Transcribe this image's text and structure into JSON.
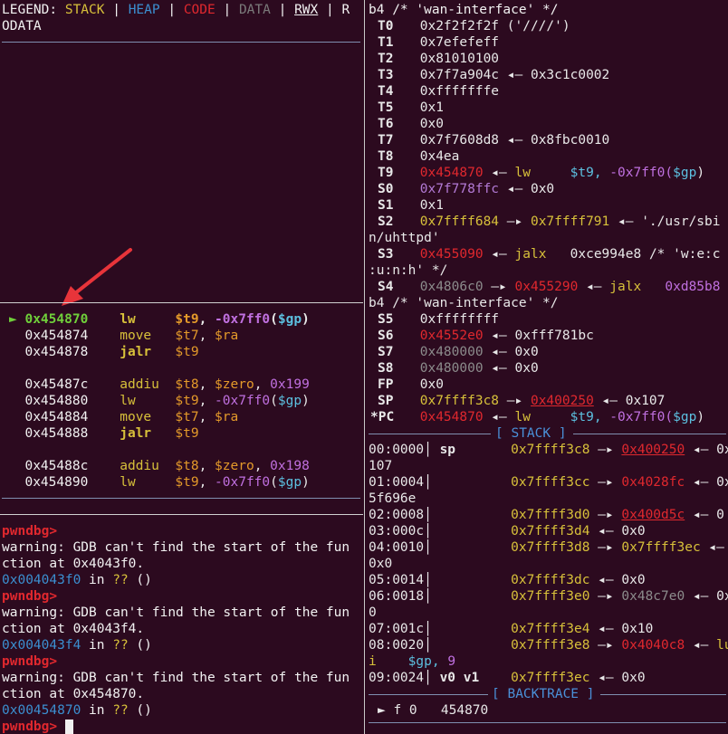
{
  "legend": {
    "label": "LEGEND: ",
    "stack": "STACK",
    "heap": "HEAP",
    "code": "CODE",
    "data": "DATA",
    "rwx": "RWX",
    "sep": " | ",
    "rodata_head": "R",
    "rodata_tail": "ODATA"
  },
  "disasm": {
    "rows": [
      {
        "marker": "►",
        "addr": "0x454870",
        "op": "lw",
        "args": [
          "$t9",
          "-0x7ff0",
          "$gp"
        ],
        "current": true
      },
      {
        "addr": "0x454874",
        "op": "move",
        "args": [
          "$t7",
          "$ra"
        ]
      },
      {
        "addr": "0x454878",
        "op": "jalr",
        "args": [
          "$t9"
        ]
      },
      {
        "addr": "0x45487c",
        "op": "addiu",
        "args": [
          "$t8",
          "$zero",
          "0x199"
        ]
      },
      {
        "addr": "0x454880",
        "op": "lw",
        "args": [
          "$t9",
          "-0x7ff0",
          "$gp"
        ]
      },
      {
        "addr": "0x454884",
        "op": "move",
        "args": [
          "$t7",
          "$ra"
        ]
      },
      {
        "addr": "0x454888",
        "op": "jalr",
        "args": [
          "$t9"
        ]
      },
      {
        "addr": "0x45488c",
        "op": "addiu",
        "args": [
          "$t8",
          "$zero",
          "0x198"
        ]
      },
      {
        "addr": "0x454890",
        "op": "lw",
        "args": [
          "$t9",
          "-0x7ff0",
          "$gp"
        ]
      }
    ]
  },
  "console": {
    "prompt": "pwndbg>",
    "warn1a": "warning: GDB can't find the start of the fun",
    "warn1b": "ction at 0x4043f0.",
    "addr1": "0x004043f0",
    "warn2a": "warning: GDB can't find the start of the fun",
    "warn2b": "ction at 0x4043f4.",
    "addr2": "0x004043f4",
    "warn3a": "warning: GDB can't find the start of the fun",
    "warn3b": "ction at 0x454870.",
    "addr3": "0x00454870",
    "in_text": " in ",
    "unknown": "??",
    "parens": " ()"
  },
  "registers": {
    "b4_line": "b4 /* 'wan-interface' */",
    "t0": "0x2f2f2f2f ('////')",
    "t1": "0x7efefeff",
    "t2": "0x81010100",
    "t3a": "0x7f7a904c",
    "t3b": "0x3c1c0002",
    "t4": "0xfffffffe",
    "t5": "0x1",
    "t6": "0x0",
    "t7a": "0x7f7608d8",
    "t7b": "0x8fbc0010",
    "t8": "0x4ea",
    "t9a": "0x454870",
    "t9op": "lw",
    "t9r": "$t9,",
    "t9o": "-0x7ff0(",
    "t9g": "$gp",
    "s0a": "0x7f778ffc",
    "s0b": "0x0",
    "s1": "0x1",
    "s2a": "0x7ffff684",
    "s2b": "0x7ffff791",
    "s2c": "'./usr/sbi",
    "s2d": "n/uhttpd'",
    "s3a": "0x455090",
    "s3op": "jalx",
    "s3b": "0xce994e8",
    "s3c": "/* 'w:e:c",
    "s3d": ":u:n:h' */",
    "s4a": "0x4806c0",
    "s4b": "0x455290",
    "s4op": "jalx",
    "s4c": "0xd85b8",
    "s4d": "b4 /* 'wan-interface' */",
    "s5": "0xffffffff",
    "s6a": "0x4552e0",
    "s6b": "0xfff781bc",
    "s7a": "0x480000",
    "s7b": "0x0",
    "s8a": "0x480000",
    "s8b": "0x0",
    "fp": "0x0",
    "spa": "0x7ffff3c8",
    "spb": "0x400250",
    "spc": "0x107",
    "pca": "0x454870"
  },
  "stack_header": "[ STACK ]",
  "stack": {
    "r0a": "00:0000",
    "r0b": "sp",
    "r0c": "0x7ffff3c8",
    "r0d": "0x400250",
    "r0e": "0x",
    "r0f": "107",
    "r1a": "01:0004",
    "r1c": "0x7ffff3cc",
    "r1d": "0x4028fc",
    "r1e": "0x",
    "r1f": "5f696e",
    "r2a": "02:0008",
    "r2c": "0x7ffff3d0",
    "r2d": "0x400d5c",
    "r2e": "0",
    "r3a": "03:000c",
    "r3c": "0x7ffff3d4",
    "r3d": "0x0",
    "r4a": "04:0010",
    "r4c": "0x7ffff3d8",
    "r4d": "0x7ffff3ec",
    "r4f": "0x0",
    "r5a": "05:0014",
    "r5c": "0x7ffff3dc",
    "r5d": "0x0",
    "r6a": "06:0018",
    "r6c": "0x7ffff3e0",
    "r6d": "0x48c7e0",
    "r6e": "0x",
    "r6f": "0",
    "r7a": "07:001c",
    "r7c": "0x7ffff3e4",
    "r7d": "0x10",
    "r8a": "08:0020",
    "r8c": "0x7ffff3e8",
    "r8d": "0x4040c8",
    "r8e": "lu",
    "r8f": "i",
    "r8g": "$gp,",
    "r8h": "9",
    "r9a": "09:0024",
    "r9b": "v0 v1",
    "r9c": "0x7ffff3ec",
    "r9d": "0x0"
  },
  "backtrace_header": "[ BACKTRACE ]",
  "backtrace": {
    "marker": "►",
    "frame": "f 0",
    "addr": "454870"
  }
}
